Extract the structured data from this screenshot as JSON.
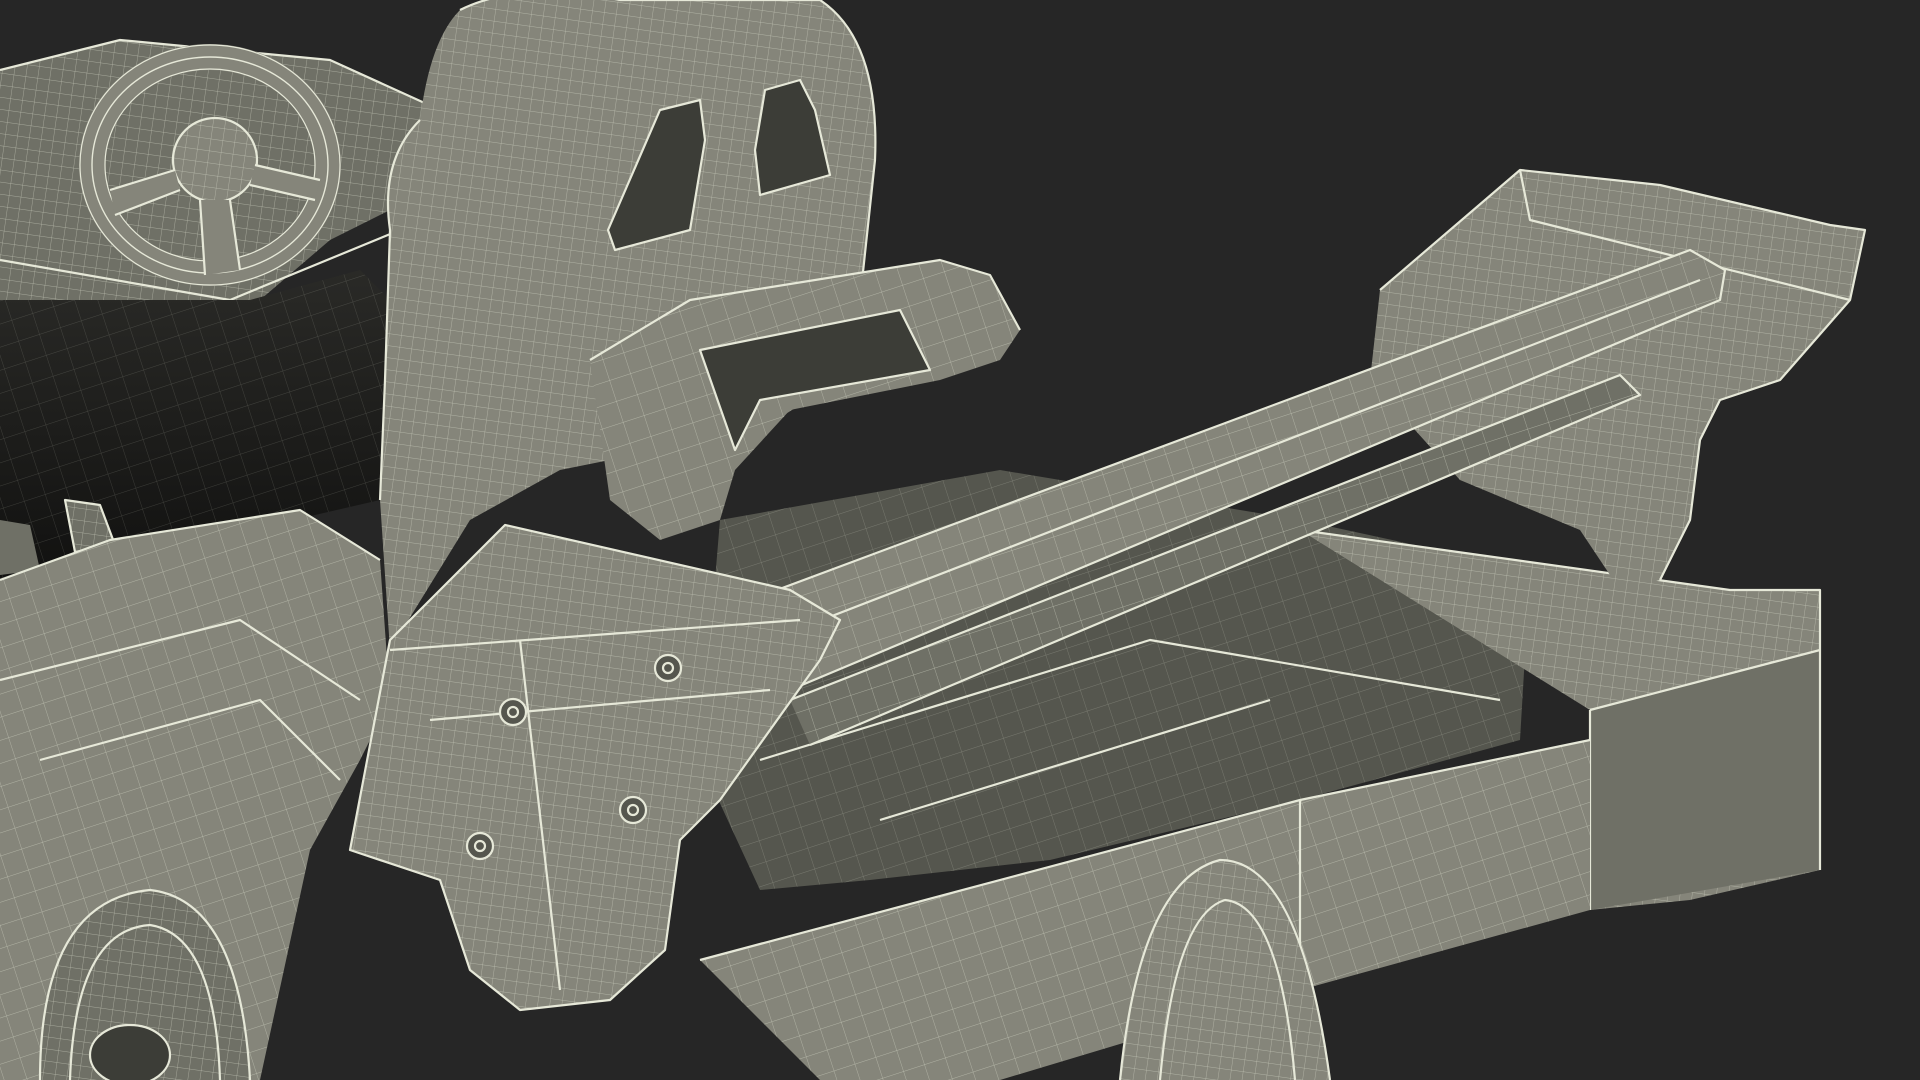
{
  "scene": {
    "background_color": "#262626",
    "mesh_base_color": "#85857a",
    "wireframe_color": "#e6e8d8",
    "bolt_count": 4
  }
}
